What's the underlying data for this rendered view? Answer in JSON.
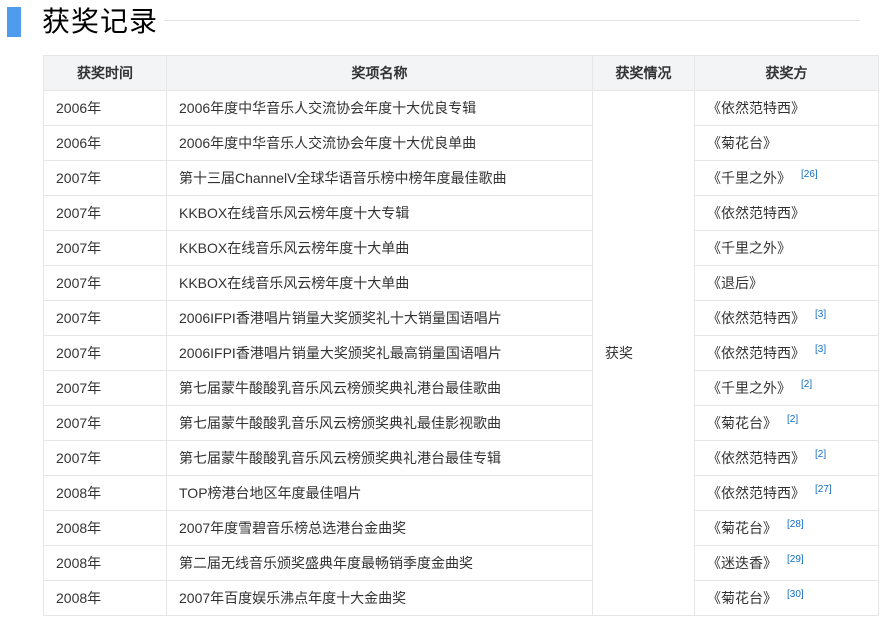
{
  "section": {
    "title": "获奖记录",
    "accent_color": "#4f9cee"
  },
  "table": {
    "headers": [
      "获奖时间",
      "奖项名称",
      "获奖情况",
      "获奖方"
    ],
    "status": "获奖",
    "rows": [
      {
        "year": "2006年",
        "award": "2006年度中华音乐人交流协会年度十大优良专辑",
        "recipient": "《依然范特西》",
        "ref": ""
      },
      {
        "year": "2006年",
        "award": "2006年度中华音乐人交流协会年度十大优良单曲",
        "recipient": "《菊花台》",
        "ref": ""
      },
      {
        "year": "2007年",
        "award": "第十三届ChannelV全球华语音乐榜中榜年度最佳歌曲",
        "recipient": "《千里之外》",
        "ref": "[26]"
      },
      {
        "year": "2007年",
        "award": "KKBOX在线音乐风云榜年度十大专辑",
        "recipient": "《依然范特西》",
        "ref": ""
      },
      {
        "year": "2007年",
        "award": "KKBOX在线音乐风云榜年度十大单曲",
        "recipient": "《千里之外》",
        "ref": ""
      },
      {
        "year": "2007年",
        "award": "KKBOX在线音乐风云榜年度十大单曲",
        "recipient": "《退后》",
        "ref": ""
      },
      {
        "year": "2007年",
        "award": "2006IFPI香港唱片销量大奖颁奖礼十大销量国语唱片",
        "recipient": "《依然范特西》",
        "ref": "[3]"
      },
      {
        "year": "2007年",
        "award": "2006IFPI香港唱片销量大奖颁奖礼最高销量国语唱片",
        "recipient": "《依然范特西》",
        "ref": "[3]"
      },
      {
        "year": "2007年",
        "award": "第七届蒙牛酸酸乳音乐风云榜颁奖典礼港台最佳歌曲",
        "recipient": "《千里之外》",
        "ref": "[2]"
      },
      {
        "year": "2007年",
        "award": "第七届蒙牛酸酸乳音乐风云榜颁奖典礼最佳影视歌曲",
        "recipient": "《菊花台》",
        "ref": "[2]"
      },
      {
        "year": "2007年",
        "award": "第七届蒙牛酸酸乳音乐风云榜颁奖典礼港台最佳专辑",
        "recipient": "《依然范特西》",
        "ref": "[2]"
      },
      {
        "year": "2008年",
        "award": "TOP榜港台地区年度最佳唱片",
        "recipient": "《依然范特西》",
        "ref": "[27]"
      },
      {
        "year": "2008年",
        "award": "2007年度雪碧音乐榜总选港台金曲奖",
        "recipient": "《菊花台》",
        "ref": "[28]"
      },
      {
        "year": "2008年",
        "award": "第二届无线音乐颁奖盛典年度最畅销季度金曲奖",
        "recipient": "《迷迭香》",
        "ref": "[29]"
      },
      {
        "year": "2008年",
        "award": "2007年百度娱乐沸点年度十大金曲奖",
        "recipient": "《菊花台》",
        "ref": "[30]"
      }
    ]
  }
}
